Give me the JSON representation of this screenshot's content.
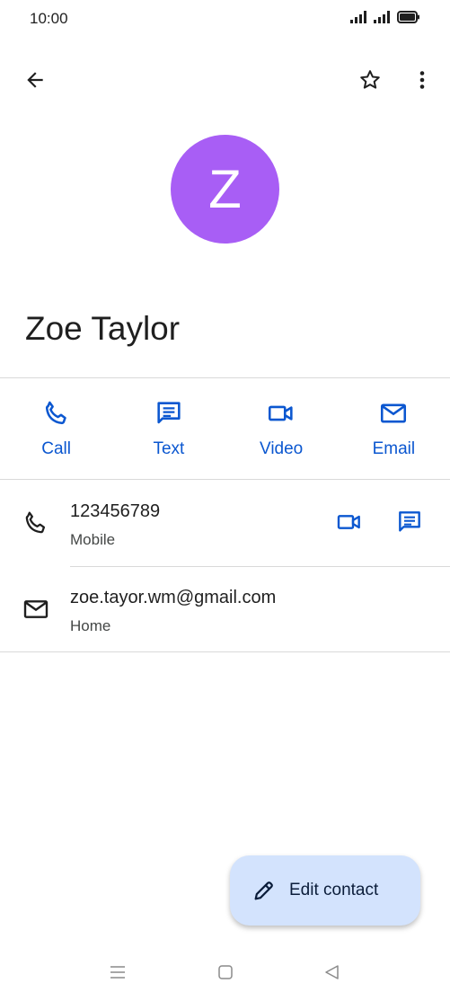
{
  "status_bar": {
    "time": "10:00"
  },
  "contact": {
    "initial": "Z",
    "name": "Zoe Taylor",
    "avatar_color": "#a85ef5"
  },
  "actions": [
    {
      "label": "Call",
      "icon": "phone-icon"
    },
    {
      "label": "Text",
      "icon": "message-icon"
    },
    {
      "label": "Video",
      "icon": "video-icon"
    },
    {
      "label": "Email",
      "icon": "email-icon"
    }
  ],
  "details": {
    "phone": {
      "value": "123456789",
      "type": "Mobile"
    },
    "email": {
      "value": "zoe.tayor.wm@gmail.com",
      "type": "Home"
    }
  },
  "fab": {
    "label": "Edit contact",
    "icon": "pencil-icon"
  },
  "colors": {
    "accent": "#0b57d0",
    "fab_bg": "#d3e3fd"
  },
  "nav_bar": [
    "menu-icon",
    "home-icon",
    "back-icon"
  ]
}
